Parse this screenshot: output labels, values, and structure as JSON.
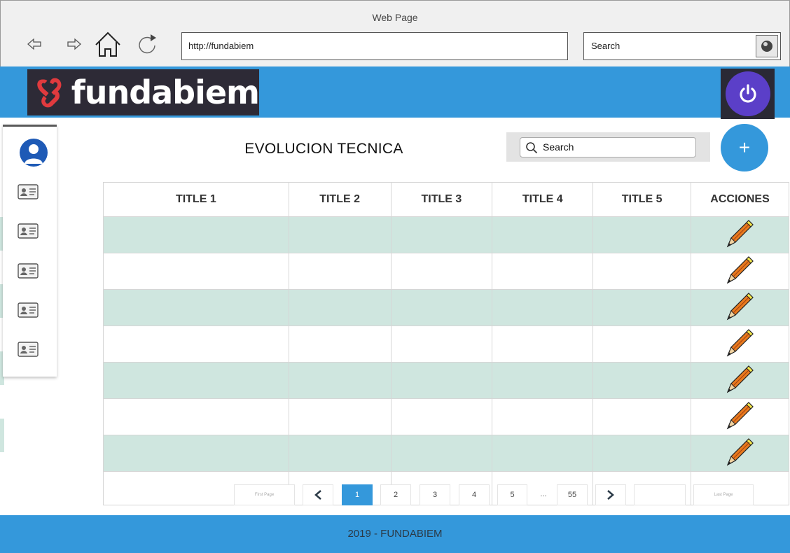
{
  "browser": {
    "window_title": "Web Page",
    "url": "http://fundabiem",
    "search_placeholder": "Search"
  },
  "header": {
    "logo_text": "fundabiem",
    "brand_color": "#3498db",
    "power_color": "#5b3fc8"
  },
  "sidebar": {
    "items": [
      {
        "icon": "id-card-icon"
      },
      {
        "icon": "id-card-icon"
      },
      {
        "icon": "id-card-icon"
      },
      {
        "icon": "id-card-icon"
      },
      {
        "icon": "id-card-icon"
      }
    ]
  },
  "main": {
    "title": "EVOLUCION TECNICA",
    "search_placeholder": "Search",
    "add_label": "+"
  },
  "table": {
    "headers": [
      "TITLE 1",
      "TITLE 2",
      "TITLE 3",
      "TITLE 4",
      "TITLE 5",
      "ACCIONES"
    ],
    "row_fill": "#cfe6df"
  },
  "pagination": {
    "first": "First Page",
    "pages": [
      "1",
      "2",
      "3",
      "4",
      "5"
    ],
    "ellipsis": "...",
    "last_num": "55",
    "last": "Last Page",
    "active": "1"
  },
  "footer": {
    "text": "2019 - FUNDABIEM"
  }
}
